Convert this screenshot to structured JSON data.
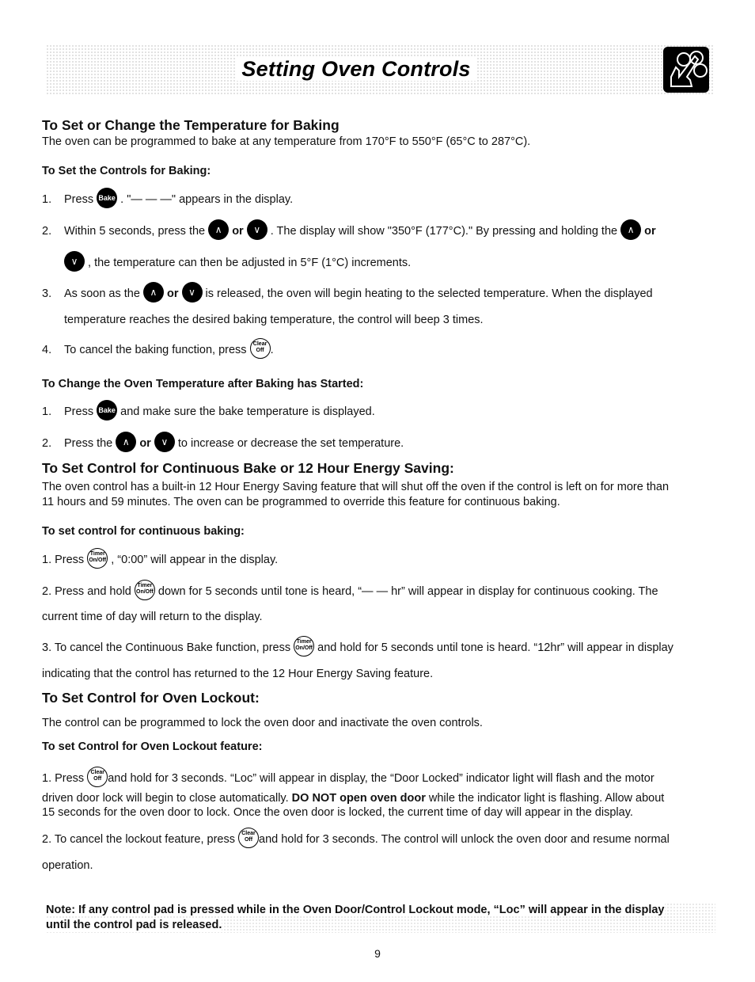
{
  "header": {
    "title": "Setting Oven Controls",
    "icon": "hand-pressing-buttons-icon"
  },
  "section1": {
    "heading": "To Set or Change the Temperature for Baking",
    "intro": "The oven can be programmed to bake at any temperature from 170°F to 550°F (65°C to 287°C).",
    "subheading": "To Set the Controls for Baking:",
    "steps": [
      {
        "num": "1.",
        "a": "Press",
        "b": ". \"— — —\" appears in the display."
      },
      {
        "num": "2.",
        "a": "Within 5 seconds, press the",
        "or": "or",
        "b": ". The display will show \"350°F (177°C).\" By pressing and holding the",
        "c": ", the temperature can then be adjusted in 5°F (1°C) increments."
      },
      {
        "num": "3.",
        "a": "As soon as the",
        "or": "or",
        "b": "is released, the oven will begin heating to the selected temperature. When the displayed",
        "c": "temperature reaches the desired baking temperature, the control will beep 3 times."
      },
      {
        "num": "4.",
        "a": "To cancel the baking function, press",
        "b": "."
      }
    ]
  },
  "section2": {
    "subheading": "To Change the Oven Temperature after Baking has Started:",
    "steps": [
      {
        "num": "1.",
        "a": "Press",
        "b": "and make sure the bake temperature is displayed."
      },
      {
        "num": "2.",
        "a": "Press the",
        "or": "or",
        "b": "to increase or decrease the set temperature."
      }
    ]
  },
  "section3": {
    "heading": "To Set Control for Continuous Bake or 12 Hour Energy Saving:",
    "intro1": "The oven control has a built-in 12 Hour Energy Saving feature that will shut off the oven if the control is left on for more than",
    "intro2": "11 hours and 59 minutes. The oven can be programmed to override this feature for continuous baking.",
    "subheading": "To set control for continuous baking:",
    "steps": [
      {
        "a": "1. Press",
        "b": ", “0:00” will appear in the display."
      },
      {
        "a": "2. Press and hold",
        "b": "down for 5 seconds until tone is heard, “— —  hr” will appear in display for continuous cooking. The",
        "c": "current time of day will return to the display."
      },
      {
        "a": "3. To cancel the Continuous Bake function, press",
        "b": "and hold for 5 seconds until tone is heard. “12hr” will appear in display",
        "c": "indicating that the control has returned to the 12 Hour Energy Saving feature."
      }
    ]
  },
  "section4": {
    "heading": "To Set Control for Oven Lockout:",
    "intro": "The control can be programmed to lock the oven door and inactivate the oven controls.",
    "subheading": "To set Control for Oven Lockout feature:",
    "steps": [
      {
        "a": "1. Press",
        "b": "and hold for 3 seconds. “Loc” will appear in display, the “Door Locked” indicator light will flash and the motor",
        "c1": "driven door lock will begin to close automatically.",
        "bold": "DO NOT open oven door",
        "c2": "while the indicator light is flashing. Allow about",
        "d": "15 seconds for the oven door to lock. Once the oven door is locked, the current time of day will appear in the display."
      },
      {
        "a": "2. To cancel the lockout feature, press",
        "b": "and hold for 3 seconds. The control will unlock the oven door and resume normal",
        "c": "operation."
      }
    ]
  },
  "note": {
    "line1": "Note: If any control pad is pressed while in the Oven Door/Control Lockout mode, “Loc” will appear in the display",
    "line2": "until the control pad is released."
  },
  "buttons": {
    "bake": "Bake",
    "up": "∧",
    "down": "∨",
    "clear_top": "Clear",
    "clear_bottom": "Off",
    "timer_top": "Timer",
    "timer_bottom": "On/Off"
  },
  "page_number": "9"
}
